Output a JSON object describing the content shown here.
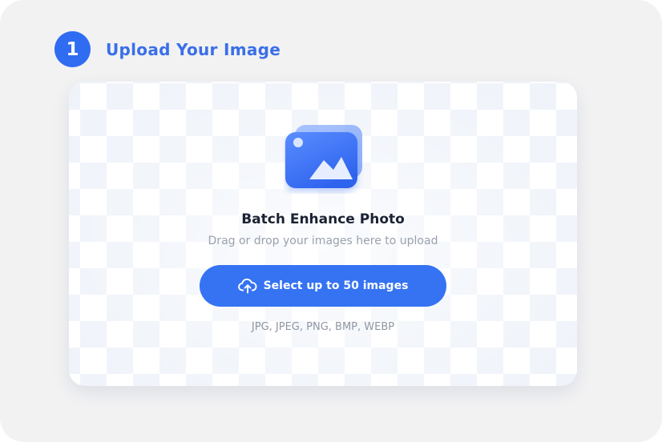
{
  "step": {
    "number": "1",
    "title": "Upload Your Image"
  },
  "upload": {
    "icon": "photo-stack-icon",
    "title": "Batch Enhance Photo",
    "subtitle": "Drag or drop your images here to upload",
    "button_label": "Select up to 50 images",
    "button_icon": "cloud-upload-icon",
    "formats": "JPG, JPEG, PNG, BMP, WEBP"
  },
  "colors": {
    "accent": "#3573f2",
    "panel_bg": "#f2f2f3",
    "title_text": "#1b2233",
    "muted_text": "#9aa1ad"
  }
}
